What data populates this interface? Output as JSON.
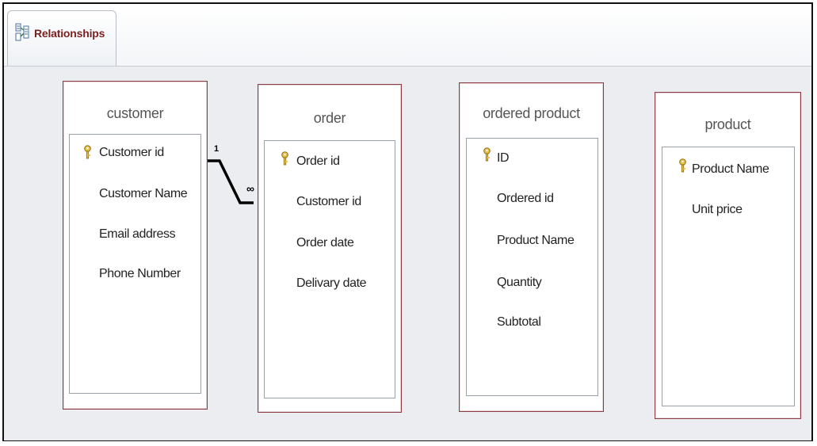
{
  "tab": {
    "label": "Relationships",
    "icon": "relationships-icon"
  },
  "relationship": {
    "one_label": "1",
    "many_label": "∞"
  },
  "tables": {
    "customer": {
      "title": "customer",
      "fields": [
        "Customer id",
        "Customer Name",
        "Email address",
        "Phone Number"
      ],
      "key_field": "Customer id"
    },
    "order": {
      "title": "order",
      "fields": [
        "Order id",
        "Customer id",
        "Order date",
        "Delivary date"
      ],
      "key_field": "Order id"
    },
    "ordered_product": {
      "title": "ordered product",
      "fields": [
        "ID",
        "Ordered id",
        "Product Name",
        "Quantity",
        "Subtotal"
      ],
      "key_field": "ID"
    },
    "product": {
      "title": "product",
      "fields": [
        "Product Name",
        "Unit price"
      ],
      "key_field": "Product Name"
    }
  },
  "colors": {
    "table_border": "#8e3b46",
    "tab_text": "#7a1f1f",
    "key_icon": "#e0b73c",
    "canvas": "#ecedf0"
  }
}
